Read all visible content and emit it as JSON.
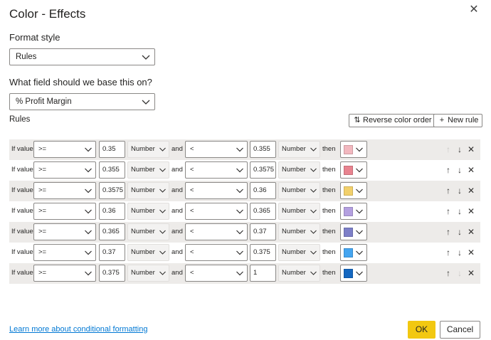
{
  "dialog": {
    "title": "Color - Effects",
    "close_glyph": "✕"
  },
  "format_style": {
    "label": "Format style",
    "value": "Rules"
  },
  "field": {
    "label": "What field should we base this on?",
    "value": "% Profit Margin"
  },
  "rules_section": {
    "label": "Rules",
    "reverse_label": "Reverse color order",
    "new_rule_label": "New rule"
  },
  "rule_text": {
    "if_value": "If value",
    "and": "and",
    "then": "then"
  },
  "rules": [
    {
      "op1": ">=",
      "v1": "0.35",
      "t1": "Number",
      "op2": "<",
      "v2": "0.355",
      "t2": "Number",
      "color": "#f2b8bf",
      "up_enabled": false,
      "down_enabled": true
    },
    {
      "op1": ">=",
      "v1": "0.355",
      "t1": "Number",
      "op2": "<",
      "v2": "0.3575",
      "t2": "Number",
      "color": "#e8838f",
      "up_enabled": true,
      "down_enabled": true
    },
    {
      "op1": ">=",
      "v1": "0.3575",
      "t1": "Number",
      "op2": "<",
      "v2": "0.36",
      "t2": "Number",
      "color": "#f2d06b",
      "up_enabled": true,
      "down_enabled": true
    },
    {
      "op1": ">=",
      "v1": "0.36",
      "t1": "Number",
      "op2": "<",
      "v2": "0.365",
      "t2": "Number",
      "color": "#b4a0e0",
      "up_enabled": true,
      "down_enabled": true
    },
    {
      "op1": ">=",
      "v1": "0.365",
      "t1": "Number",
      "op2": "<",
      "v2": "0.37",
      "t2": "Number",
      "color": "#7d7fc8",
      "up_enabled": true,
      "down_enabled": true
    },
    {
      "op1": ">=",
      "v1": "0.37",
      "t1": "Number",
      "op2": "<",
      "v2": "0.375",
      "t2": "Number",
      "color": "#45a5f0",
      "up_enabled": true,
      "down_enabled": true
    },
    {
      "op1": ">=",
      "v1": "0.375",
      "t1": "Number",
      "op2": "<",
      "v2": "1",
      "t2": "Number",
      "color": "#1467c0",
      "up_enabled": true,
      "down_enabled": false
    }
  ],
  "footer": {
    "learn_more": "Learn more about conditional formatting",
    "ok_label": "OK",
    "cancel_label": "Cancel"
  },
  "colors": {
    "accent_ok": "#f2c811",
    "link": "#0078d4",
    "row_shade": "#edebe9"
  }
}
